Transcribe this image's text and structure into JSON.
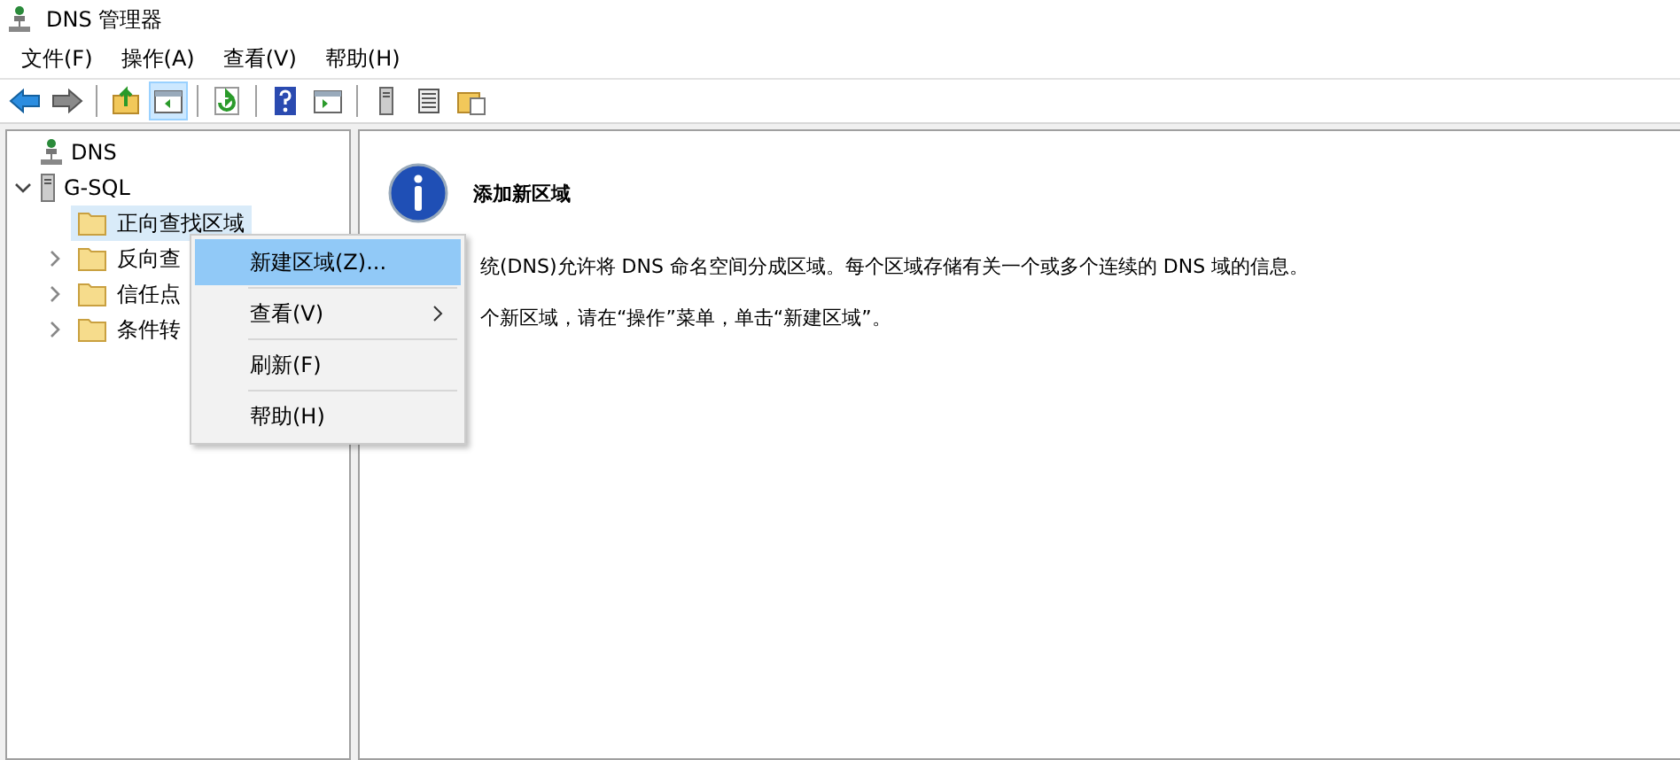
{
  "window": {
    "title": "DNS 管理器"
  },
  "menu_bar": [
    "文件(F)",
    "操作(A)",
    "查看(V)",
    "帮助(H)"
  ],
  "toolbar": [
    {
      "kind": "back",
      "pressed": false
    },
    {
      "kind": "forward",
      "pressed": false
    },
    {
      "kind": "sep"
    },
    {
      "kind": "up",
      "pressed": false
    },
    {
      "kind": "tree",
      "pressed": true
    },
    {
      "kind": "sep"
    },
    {
      "kind": "refresh",
      "pressed": false
    },
    {
      "kind": "sep"
    },
    {
      "kind": "help",
      "pressed": false
    },
    {
      "kind": "pane",
      "pressed": false
    },
    {
      "kind": "sep"
    },
    {
      "kind": "server",
      "pressed": false
    },
    {
      "kind": "list",
      "pressed": false
    },
    {
      "kind": "folder",
      "pressed": false
    }
  ],
  "tree": [
    {
      "label": "DNS",
      "kind": "root",
      "children": [
        {
          "label": "G-SQL",
          "kind": "server",
          "expanded": true,
          "children": [
            {
              "label": "正向查找区域",
              "kind": "folder",
              "selected": true,
              "expandable": false
            },
            {
              "label": "反向查",
              "kind": "folder",
              "selected": false,
              "expandable": true
            },
            {
              "label": "信任点",
              "kind": "folder",
              "selected": false,
              "expandable": true
            },
            {
              "label": "条件转",
              "kind": "folder",
              "selected": false,
              "expandable": true
            }
          ]
        }
      ]
    }
  ],
  "content": {
    "title": "添加新区域",
    "lines": [
      "统(DNS)允许将 DNS 命名空间分成区域。每个区域存储有关一个或多个连续的 DNS 域的信息。",
      "个新区域，请在“操作”菜单，单击“新建区域”。"
    ]
  },
  "context_menu": [
    {
      "label": "新建区域(Z)...",
      "selected": true,
      "submenu": false
    },
    {
      "label": "查看(V)",
      "selected": false,
      "submenu": true
    },
    {
      "label": "刷新(F)",
      "selected": false,
      "submenu": false
    },
    {
      "label": "帮助(H)",
      "selected": false,
      "submenu": false
    }
  ]
}
